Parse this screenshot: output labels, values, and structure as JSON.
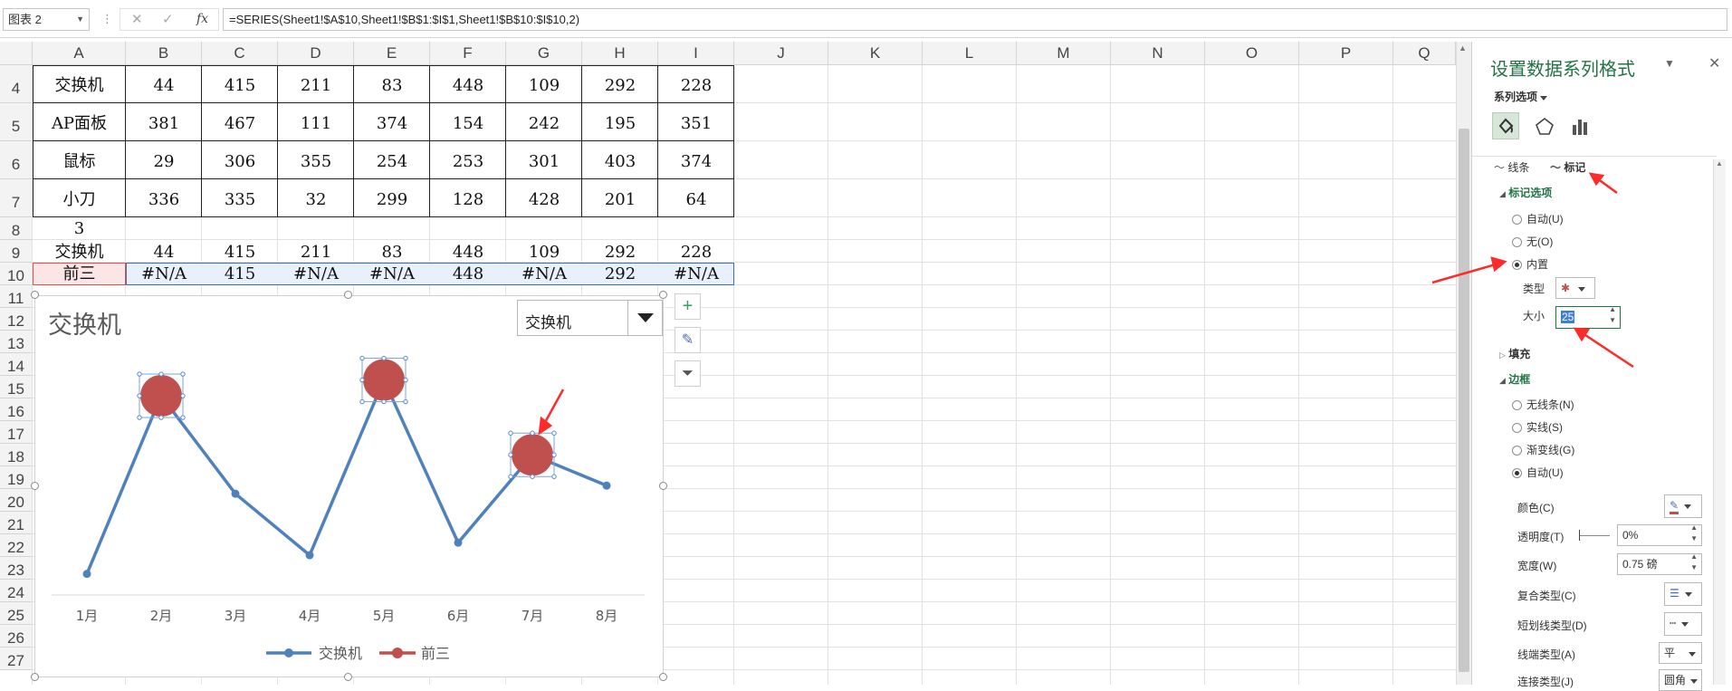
{
  "formula_bar": {
    "name_box": "图表 2",
    "cancel_icon": "✕",
    "confirm_icon": "✓",
    "fx_label": "fx",
    "formula": "=SERIES(Sheet1!$A$10,Sheet1!$B$1:$I$1,Sheet1!$B$10:$I$10,2)"
  },
  "grid": {
    "columns": [
      "A",
      "B",
      "C",
      "D",
      "E",
      "F",
      "G",
      "H",
      "I",
      "J",
      "K",
      "L",
      "M",
      "N",
      "O",
      "P",
      "Q"
    ],
    "rows": [
      "4",
      "5",
      "6",
      "7",
      "8",
      "9",
      "10",
      "11",
      "12",
      "13",
      "14",
      "15",
      "16",
      "17",
      "18",
      "19",
      "20",
      "21",
      "22",
      "23",
      "24",
      "25",
      "26",
      "27"
    ],
    "table_rows": [
      [
        "交换机",
        "44",
        "415",
        "211",
        "83",
        "448",
        "109",
        "292",
        "228"
      ],
      [
        "AP面板",
        "381",
        "467",
        "111",
        "374",
        "154",
        "242",
        "195",
        "351"
      ],
      [
        "鼠标",
        "29",
        "306",
        "355",
        "254",
        "253",
        "301",
        "403",
        "374"
      ],
      [
        "小刀",
        "336",
        "335",
        "32",
        "299",
        "128",
        "428",
        "201",
        "64"
      ]
    ],
    "row8": [
      "3"
    ],
    "row9": [
      "交换机",
      "44",
      "415",
      "211",
      "83",
      "448",
      "109",
      "292",
      "228"
    ],
    "row10": [
      "前三",
      "#N/A",
      "415",
      "#N/A",
      "#N/A",
      "448",
      "#N/A",
      "292",
      "#N/A"
    ]
  },
  "chart": {
    "dropdown_value": "交换机",
    "side_buttons": [
      "+",
      "✎",
      "⏷"
    ]
  },
  "chart_data": {
    "type": "line",
    "title": "交换机",
    "categories": [
      "1月",
      "2月",
      "3月",
      "4月",
      "5月",
      "6月",
      "7月",
      "8月"
    ],
    "series": [
      {
        "name": "交换机",
        "values": [
          44,
          415,
          211,
          83,
          448,
          109,
          292,
          228
        ],
        "color": "#4f81bd"
      },
      {
        "name": "前三",
        "values": [
          null,
          415,
          null,
          null,
          448,
          null,
          292,
          null
        ],
        "color": "#c0504d"
      }
    ],
    "ylim": [
      0,
      500
    ],
    "grid": false,
    "legend": "bottom"
  },
  "pane": {
    "title": "设置数据系列格式",
    "series_options": "系列选项",
    "tab_line": "线条",
    "tab_marker": "标记",
    "marker_options": "标记选项",
    "radio_auto": "自动(U)",
    "radio_none": "无(O)",
    "radio_builtin": "内置",
    "type_label": "类型",
    "size_label": "大小",
    "size_value": "25",
    "fill": "填充",
    "border": "边框",
    "b_none": "无线条(N)",
    "b_solid": "实线(S)",
    "b_grad": "渐变线(G)",
    "b_auto": "自动(U)",
    "color_label": "颜色(C)",
    "transparency_label": "透明度(T)",
    "transparency_value": "0%",
    "width_label": "宽度(W)",
    "width_value": "0.75 磅",
    "compound_label": "复合类型(C)",
    "dash_label": "短划线类型(D)",
    "cap_label": "线端类型(A)",
    "cap_value": "平",
    "join_label": "连接类型(J)",
    "join_value": "圆角"
  },
  "colors": {
    "accent_green": "#217346",
    "line_blue": "#4f81bd",
    "marker_red": "#c0504d",
    "arrow_red": "#ff2a2a"
  }
}
